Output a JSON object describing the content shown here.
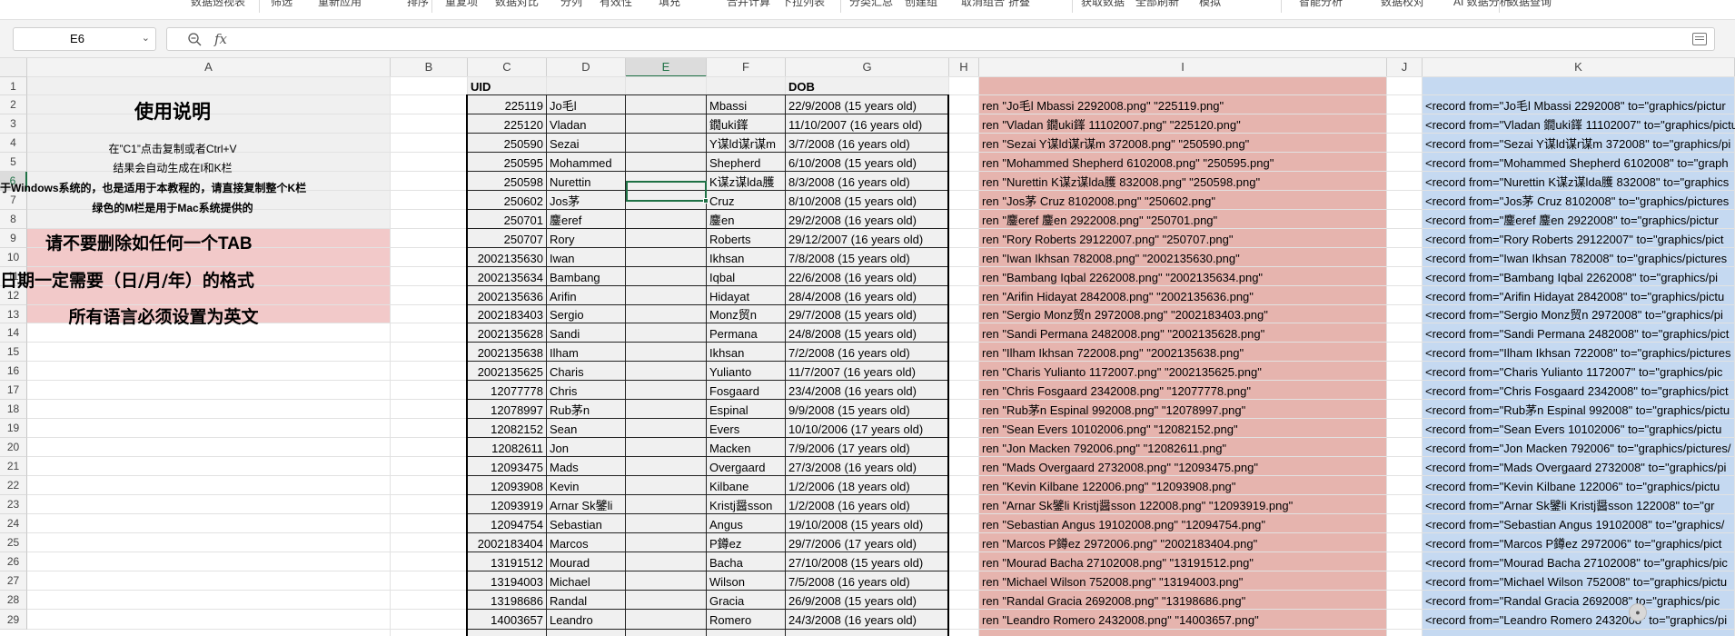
{
  "ribbon": {
    "items": [
      "数据透视表",
      "筛选",
      "重新应用",
      "排序",
      "重复项",
      "数据对比",
      "分列",
      "有效性",
      "填充",
      "合并计算",
      "下拉列表",
      "分类汇总",
      "创建组",
      "取消组合",
      "折叠",
      "获取数据",
      "全部刷新",
      "模拟",
      "智能分析",
      "数据校对",
      "AI 数据分析",
      "数据查询"
    ]
  },
  "formula_bar": {
    "name_box": "E6",
    "formula": ""
  },
  "columns": [
    "A",
    "B",
    "C",
    "D",
    "E",
    "F",
    "G",
    "H",
    "I",
    "J",
    "K"
  ],
  "selected_column": "E",
  "rows": [
    1,
    2,
    3,
    4,
    5,
    6,
    7,
    8,
    9,
    10,
    11,
    12,
    13,
    14,
    15,
    16,
    17,
    18,
    19,
    20,
    21,
    22,
    23,
    24,
    25,
    26,
    27,
    28,
    29
  ],
  "selected_row": 6,
  "instructions": {
    "title": "使用说明",
    "line1": "在”C1”点击复制或者Ctrl+V",
    "line2": "结果会自动生成在I和K栏",
    "line3": "于Windows系统的，也是适用于本教程的，请直接复制整个K栏",
    "line4": "绿色的M栏是用于Mac系统提供的",
    "warn1": "请不要删除如任何一个TAB",
    "warn2": "日期一定需要（日/月/年）的格式",
    "warn3": "所有语言必须设置为英文"
  },
  "headers": {
    "uid": "UID",
    "dob": "DOB"
  },
  "colors": {
    "accent": "#1e7145",
    "pink": "#f2c9c9",
    "salmon": "#e6b4ae",
    "blue": "#c5d9f1",
    "grey_fill": "#f0f0f0"
  },
  "records": [
    {
      "uid": "225119",
      "first": "Jo毛l",
      "last": "Mbassi",
      "dob": "22/9/2008 (15 years old)",
      "ren": "ren \"Jo毛l  Mbassi 2292008.png\" \"225119.png\"",
      "rec": "<record from=\"Jo毛l  Mbassi 2292008\" to=\"graphics/pictur"
    },
    {
      "uid": "225120",
      "first": "Vladan",
      "last": "鐗uki鎽",
      "dob": "11/10/2007 (16 years old)",
      "ren": "ren \"Vladan  鐗uki鎽 11102007.png\" \"225120.png\"",
      "rec": "<record from=\"Vladan  鐗uki鎽 11102007\" to=\"graphics/pictu"
    },
    {
      "uid": "250590",
      "first": "Sezai",
      "last": "Y谋ld谋r谋m",
      "dob": "3/7/2008 (16 years old)",
      "ren": "ren \"Sezai  Y谋ld谋r谋m 372008.png\" \"250590.png\"",
      "rec": "<record from=\"Sezai  Y谋ld谋r谋m 372008\" to=\"graphics/pi"
    },
    {
      "uid": "250595",
      "first": "Mohammed",
      "last": "Shepherd",
      "dob": "6/10/2008 (15 years old)",
      "ren": "ren \"Mohammed  Shepherd 6102008.png\" \"250595.png\"",
      "rec": "<record from=\"Mohammed  Shepherd 6102008\" to=\"graph"
    },
    {
      "uid": "250598",
      "first": "Nurettin",
      "last": "K谋z谋lda臒",
      "dob": "8/3/2008 (16 years old)",
      "ren": "ren \"Nurettin  K谋z谋lda臒 832008.png\" \"250598.png\"",
      "rec": "<record from=\"Nurettin  K谋z谋lda臒 832008\" to=\"graphics"
    },
    {
      "uid": "250602",
      "first": "Jos茅",
      "last": "Cruz",
      "dob": "8/10/2008 (15 years old)",
      "ren": "ren \"Jos茅  Cruz 8102008.png\" \"250602.png\"",
      "rec": "<record from=\"Jos茅  Cruz 8102008\" to=\"graphics/pictures"
    },
    {
      "uid": "250701",
      "first": "鏖eref",
      "last": "鏖en",
      "dob": "29/2/2008 (16 years old)",
      "ren": "ren \"鏖eref  鏖en 2922008.png\" \"250701.png\"",
      "rec": "<record from=\"鏖eref  鏖en 2922008\" to=\"graphics/pictur"
    },
    {
      "uid": "250707",
      "first": "Rory",
      "last": "Roberts",
      "dob": "29/12/2007 (16 years old)",
      "ren": "ren \"Rory  Roberts 29122007.png\" \"250707.png\"",
      "rec": "<record from=\"Rory  Roberts 29122007\" to=\"graphics/pict"
    },
    {
      "uid": "2002135630",
      "first": "Iwan",
      "last": "Ikhsan",
      "dob": "7/8/2008 (15 years old)",
      "ren": "ren \"Iwan  Ikhsan 782008.png\" \"2002135630.png\"",
      "rec": "<record from=\"Iwan  Ikhsan 782008\" to=\"graphics/pictures"
    },
    {
      "uid": "2002135634",
      "first": "Bambang",
      "last": "Iqbal",
      "dob": "22/6/2008 (16 years old)",
      "ren": "ren \"Bambang  Iqbal 2262008.png\" \"2002135634.png\"",
      "rec": "<record from=\"Bambang  Iqbal 2262008\" to=\"graphics/pi"
    },
    {
      "uid": "2002135636",
      "first": "Arifin",
      "last": "Hidayat",
      "dob": "28/4/2008 (16 years old)",
      "ren": "ren \"Arifin  Hidayat 2842008.png\" \"2002135636.png\"",
      "rec": "<record from=\"Arifin  Hidayat 2842008\" to=\"graphics/pictu"
    },
    {
      "uid": "2002183403",
      "first": "Sergio",
      "last": "Monz贸n",
      "dob": "29/7/2008 (15 years old)",
      "ren": "ren \"Sergio  Monz贸n 2972008.png\" \"2002183403.png\"",
      "rec": "<record from=\"Sergio  Monz贸n 2972008\" to=\"graphics/pi"
    },
    {
      "uid": "2002135628",
      "first": "Sandi",
      "last": "Permana",
      "dob": "24/8/2008 (15 years old)",
      "ren": "ren \"Sandi  Permana 2482008.png\" \"2002135628.png\"",
      "rec": "<record from=\"Sandi  Permana 2482008\" to=\"graphics/pict"
    },
    {
      "uid": "2002135638",
      "first": "Ilham",
      "last": "Ikhsan",
      "dob": "7/2/2008 (16 years old)",
      "ren": "ren \"Ilham  Ikhsan 722008.png\" \"2002135638.png\"",
      "rec": "<record from=\"Ilham  Ikhsan 722008\" to=\"graphics/pictures"
    },
    {
      "uid": "2002135625",
      "first": "Charis",
      "last": "Yulianto",
      "dob": "11/7/2007 (16 years old)",
      "ren": "ren \"Charis  Yulianto 1172007.png\" \"2002135625.png\"",
      "rec": "<record from=\"Charis  Yulianto 1172007\" to=\"graphics/pic"
    },
    {
      "uid": "12077778",
      "first": "Chris",
      "last": "Fosgaard",
      "dob": "23/4/2008 (16 years old)",
      "ren": "ren \"Chris  Fosgaard 2342008.png\" \"12077778.png\"",
      "rec": "<record from=\"Chris  Fosgaard 2342008\" to=\"graphics/pict"
    },
    {
      "uid": "12078997",
      "first": "Rub茅n",
      "last": "Espinal",
      "dob": "9/9/2008 (15 years old)",
      "ren": "ren \"Rub茅n  Espinal 992008.png\" \"12078997.png\"",
      "rec": "<record from=\"Rub茅n  Espinal 992008\" to=\"graphics/pictu"
    },
    {
      "uid": "12082152",
      "first": "Sean",
      "last": "Evers",
      "dob": "10/10/2006 (17 years old)",
      "ren": "ren \"Sean  Evers 10102006.png\" \"12082152.png\"",
      "rec": "<record from=\"Sean  Evers 10102006\" to=\"graphics/pictu"
    },
    {
      "uid": "12082611",
      "first": "Jon",
      "last": "Macken",
      "dob": "7/9/2006 (17 years old)",
      "ren": "ren \"Jon  Macken 792006.png\" \"12082611.png\"",
      "rec": "<record from=\"Jon  Macken 792006\" to=\"graphics/pictures/"
    },
    {
      "uid": "12093475",
      "first": "Mads",
      "last": "Overgaard",
      "dob": "27/3/2008 (16 years old)",
      "ren": "ren \"Mads  Overgaard 2732008.png\" \"12093475.png\"",
      "rec": "<record from=\"Mads  Overgaard 2732008\" to=\"graphics/pi"
    },
    {
      "uid": "12093908",
      "first": "Kevin",
      "last": "Kilbane",
      "dob": "1/2/2006 (18 years old)",
      "ren": "ren \"Kevin  Kilbane 122006.png\" \"12093908.png\"",
      "rec": "<record from=\"Kevin  Kilbane 122006\" to=\"graphics/pictu"
    },
    {
      "uid": "12093919",
      "first": "Arnar Sk鐾li",
      "last": "Kristj醤sson",
      "dob": "1/2/2008 (16 years old)",
      "ren": "ren \"Arnar Sk鐾li  Kristj醤sson 122008.png\" \"12093919.png\"",
      "rec": "<record from=\"Arnar Sk鐾li  Kristj醤sson 122008\" to=\"gr"
    },
    {
      "uid": "12094754",
      "first": "Sebastian",
      "last": "Angus",
      "dob": "19/10/2008 (15 years old)",
      "ren": "ren \"Sebastian  Angus 19102008.png\" \"12094754.png\"",
      "rec": "<record from=\"Sebastian  Angus 19102008\" to=\"graphics/"
    },
    {
      "uid": "2002183404",
      "first": "Marcos",
      "last": "P鐏ez",
      "dob": "29/7/2006 (17 years old)",
      "ren": "ren \"Marcos  P鐏ez 2972006.png\" \"2002183404.png\"",
      "rec": "<record from=\"Marcos  P鐏ez 2972006\" to=\"graphics/pict"
    },
    {
      "uid": "13191512",
      "first": "Mourad",
      "last": "Bacha",
      "dob": "27/10/2008 (15 years old)",
      "ren": "ren \"Mourad  Bacha 27102008.png\" \"13191512.png\"",
      "rec": "<record from=\"Mourad  Bacha 27102008\" to=\"graphics/pic"
    },
    {
      "uid": "13194003",
      "first": "Michael",
      "last": "Wilson",
      "dob": "7/5/2008 (16 years old)",
      "ren": "ren \"Michael  Wilson 752008.png\" \"13194003.png\"",
      "rec": "<record from=\"Michael  Wilson 752008\" to=\"graphics/pictu"
    },
    {
      "uid": "13198686",
      "first": "Randal",
      "last": "Gracia",
      "dob": "26/9/2008 (15 years old)",
      "ren": "ren \"Randal  Gracia 2692008.png\" \"13198686.png\"",
      "rec": "<record from=\"Randal  Gracia 2692008\" to=\"graphics/pic"
    },
    {
      "uid": "14003657",
      "first": "Leandro",
      "last": "Romero",
      "dob": "24/3/2008 (16 years old)",
      "ren": "ren \"Leandro  Romero 2432008.png\" \"14003657.png\"",
      "rec": "<record from=\"Leandro  Romero 2432008\" to=\"graphics/pi"
    }
  ]
}
